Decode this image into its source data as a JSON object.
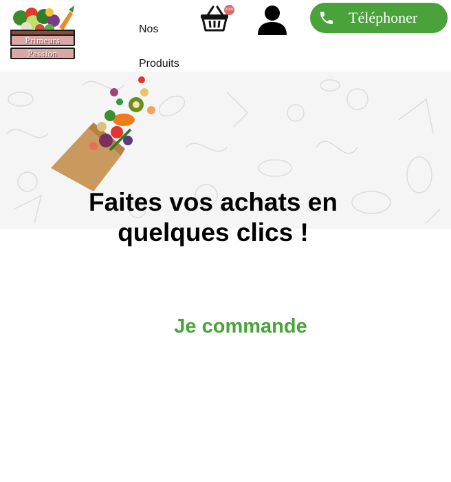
{
  "header": {
    "logo": {
      "line1": "Primeurs",
      "line2": "Passion"
    },
    "nav": {
      "products_label": "Nos\nProduits"
    },
    "cart": {
      "icon": "basket-icon",
      "badge": "0,00€"
    },
    "account": {
      "icon": "user-icon"
    },
    "call_button": {
      "label": "Téléphoner",
      "icon": "phone-icon"
    }
  },
  "hero": {
    "title": "Faites vos achats en quelques clics !",
    "illustration": "grocery-bag-illustration"
  },
  "main": {
    "cta_label": "Je commande"
  },
  "colors": {
    "brand_green": "#4aa33a",
    "badge_red": "#d46a6a",
    "logo_pink": "#d9a8a4",
    "hero_background": "#f5f5f5"
  }
}
